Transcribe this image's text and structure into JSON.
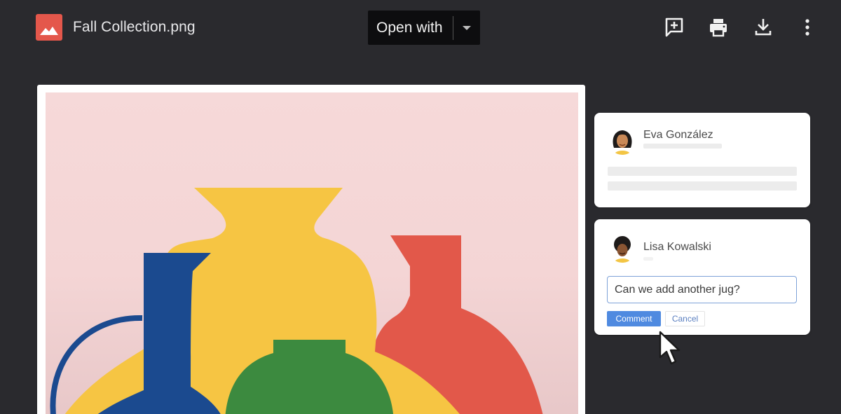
{
  "header": {
    "file_name": "Fall Collection.png",
    "file_icon": "image-file-icon",
    "open_with_label": "Open with",
    "actions": [
      "add-comment-icon",
      "print-icon",
      "download-icon",
      "more-vert-icon"
    ]
  },
  "comments": [
    {
      "author": "Eva González",
      "avatar": "avatar-eva"
    },
    {
      "author": "Lisa Kowalski",
      "avatar": "avatar-lisa",
      "input_value": "Can we add another jug?",
      "comment_label": "Comment",
      "cancel_label": "Cancel"
    }
  ],
  "colors": {
    "background": "#2a2a2e",
    "file_icon": "#e4574b",
    "accent_blue": "#4f8ae0",
    "art_pink": "#f6d9d9",
    "vase_yellow": "#f6c543",
    "vase_blue": "#1b4a8f",
    "vase_red": "#e2584a",
    "vase_green": "#3c8a3f"
  }
}
